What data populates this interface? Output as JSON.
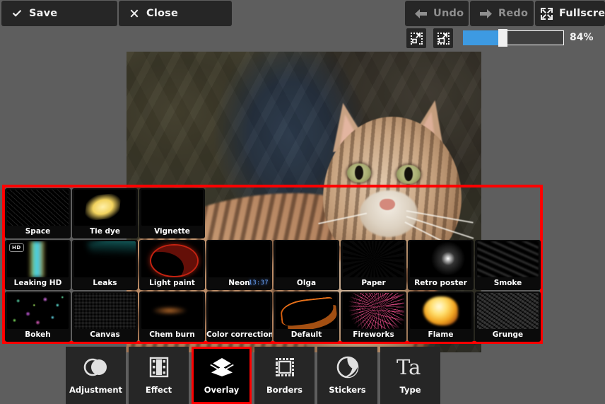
{
  "app": {
    "background_color": "#5e5e5e",
    "accent_color": "#3d9ae2",
    "highlight_color": "#ff0000"
  },
  "toolbar": {
    "save_label": "Save",
    "close_label": "Close",
    "undo_label": "Undo",
    "redo_label": "Redo",
    "fullscreen_label": "Fullscreen"
  },
  "zoom": {
    "value_label": "84%",
    "percent": 84,
    "fit_icon": "fit-to-screen-icon",
    "fill_icon": "fill-screen-icon"
  },
  "overlay_panel": {
    "selected": "Overlay",
    "rows": [
      [
        {
          "label": "Space",
          "art": "a-space",
          "badge": null
        },
        {
          "label": "Tie dye",
          "art": "a-tiedye",
          "badge": null
        },
        {
          "label": "Vignette",
          "art": "a-vignette",
          "badge": null
        }
      ],
      [
        {
          "label": "Leaking HD",
          "art": "a-leaking",
          "badge": "HD"
        },
        {
          "label": "Leaks",
          "art": "a-leaks",
          "badge": null
        },
        {
          "label": "Light paint",
          "art": "a-lightpaint",
          "badge": null
        },
        {
          "label": "Neon",
          "art": "a-neon",
          "badge": null,
          "clock": "13:37"
        },
        {
          "label": "Olga",
          "art": "a-olga",
          "badge": null
        },
        {
          "label": "Paper",
          "art": "a-paper",
          "badge": null
        },
        {
          "label": "Retro poster",
          "art": "a-retro",
          "badge": null
        },
        {
          "label": "Smoke",
          "art": "a-smoke",
          "badge": null
        }
      ],
      [
        {
          "label": "Bokeh",
          "art": "a-bokeh",
          "badge": null
        },
        {
          "label": "Canvas",
          "art": "a-canvas",
          "badge": null
        },
        {
          "label": "Chem burn",
          "art": "a-chem",
          "badge": null
        },
        {
          "label": "Color correction",
          "art": "a-colorcorr",
          "badge": null
        },
        {
          "label": "Default",
          "art": "a-default",
          "badge": null
        },
        {
          "label": "Fireworks",
          "art": "a-fireworks",
          "badge": null
        },
        {
          "label": "Flame",
          "art": "a-flame",
          "badge": null
        },
        {
          "label": "Grunge",
          "art": "a-grunge",
          "badge": null
        }
      ]
    ]
  },
  "categories": [
    {
      "label": "Adjustment",
      "icon": "adjustment-icon",
      "active": false
    },
    {
      "label": "Effect",
      "icon": "film-icon",
      "active": false
    },
    {
      "label": "Overlay",
      "icon": "layers-icon",
      "active": true
    },
    {
      "label": "Borders",
      "icon": "frame-icon",
      "active": false
    },
    {
      "label": "Stickers",
      "icon": "sticker-icon",
      "active": false
    },
    {
      "label": "Type",
      "icon": "type-icon",
      "active": false
    }
  ],
  "canvas": {
    "image_subject": "tabby-cat-photo"
  }
}
